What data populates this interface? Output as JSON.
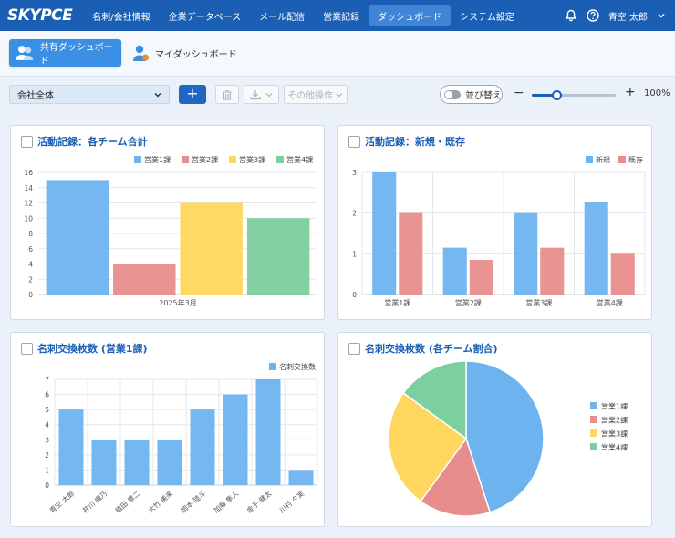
{
  "app": {
    "logo": "SKYPCE",
    "nav": [
      "名刺/会社情報",
      "企業データベース",
      "メール配信",
      "営業記録",
      "ダッシュボード",
      "システム設定"
    ],
    "active_nav": "ダッシュボード",
    "user": "青空 太郎"
  },
  "dashboards": {
    "shared_label": "共有ダッシュボード",
    "my_label": "マイダッシュボード"
  },
  "toolbar": {
    "scope_value": "会社全体",
    "add_label": "+",
    "more_label": "その他操作",
    "sort_label": "並び替え",
    "zoom_minus": "−",
    "zoom_plus": "+",
    "zoom": "100%",
    "zoom_fraction": 0.3
  },
  "colors": {
    "blue": "#6db3f0",
    "red": "#e88d8d",
    "yellow": "#ffd75e",
    "green": "#7ccf9e",
    "accent": "#1a5fb4"
  },
  "chart_data": [
    {
      "id": "c1",
      "type": "bar",
      "title": "活動記録：各チーム合計",
      "categories": [
        "2025年3月"
      ],
      "series": [
        {
          "name": "営業1課",
          "values": [
            15
          ],
          "color": "#6db3f0"
        },
        {
          "name": "営業2課",
          "values": [
            4
          ],
          "color": "#e88d8d"
        },
        {
          "name": "営業3課",
          "values": [
            12
          ],
          "color": "#ffd75e"
        },
        {
          "name": "営業4課",
          "values": [
            10
          ],
          "color": "#7ccf9e"
        }
      ],
      "yticks": [
        "0",
        "2",
        "4",
        "6",
        "8",
        "10",
        "12",
        "14",
        "16"
      ],
      "ylim": [
        0,
        16
      ],
      "legend": "top-right"
    },
    {
      "id": "c2",
      "type": "bar",
      "title": "活動記録：新規・既存",
      "categories": [
        "営業1課",
        "営業2課",
        "営業3課",
        "営業4課"
      ],
      "series": [
        {
          "name": "新規",
          "values": [
            3,
            1.15,
            2,
            2.28
          ],
          "color": "#6db3f0"
        },
        {
          "name": "既存",
          "values": [
            2,
            0.85,
            1.15,
            1
          ],
          "color": "#e88d8d"
        }
      ],
      "yticks": [
        "0",
        "1",
        "2",
        "3"
      ],
      "ylim": [
        0,
        3
      ],
      "legend": "top-right"
    },
    {
      "id": "c3",
      "type": "bar",
      "title": "名刺交換枚数 (営業1課)",
      "categories": [
        "青空 太郎",
        "井川 織乃",
        "植田 章二",
        "大竹 美来",
        "岡本 陸斗",
        "加藤 隼人",
        "金子 健太",
        "川村 夕実"
      ],
      "series": [
        {
          "name": "名刺交換数",
          "values": [
            5,
            3,
            3,
            3,
            5,
            6,
            7,
            1
          ],
          "color": "#6db3f0"
        }
      ],
      "yticks": [
        "0",
        "1",
        "2",
        "3",
        "4",
        "5",
        "6",
        "7"
      ],
      "ylim": [
        0,
        7
      ],
      "legend": "top-right"
    },
    {
      "id": "c4",
      "type": "pie",
      "title": "名刺交換枚数 (各チーム割合)",
      "slices": [
        {
          "name": "営業1課",
          "value": 45,
          "color": "#6db3f0"
        },
        {
          "name": "営業2課",
          "value": 15,
          "color": "#e88d8d"
        },
        {
          "name": "営業3課",
          "value": 25,
          "color": "#ffd75e"
        },
        {
          "name": "営業4課",
          "value": 15,
          "color": "#7ccf9e"
        }
      ],
      "legend": "right"
    }
  ]
}
